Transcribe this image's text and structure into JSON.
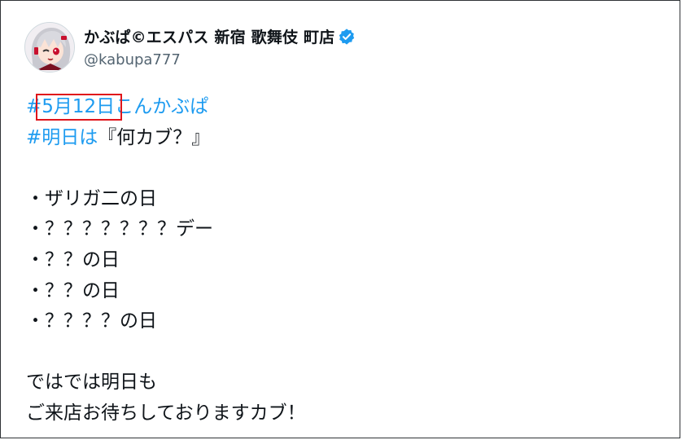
{
  "author": {
    "display_name": "かぶぱ©エスパス 新宿 歌舞伎 町店",
    "handle": "@kabupa777",
    "verified_badge_icon": "verified-badge-icon",
    "avatar_icon": "avatar-anime-character"
  },
  "post": {
    "line1": {
      "hash": "#",
      "highlighted": "5月12日",
      "rest": "こんかぶぱ"
    },
    "line2": {
      "tag": "#明日は",
      "rest": "『何カブ？』"
    },
    "items": [
      "・ザリガ二の日",
      "・？？？？？？？デー",
      "・？？の日",
      "・？？の日",
      "・？？？？の日"
    ],
    "closing": [
      "ではでは明日も",
      "ご来店お待ちしておりますカブ！"
    ]
  },
  "colors": {
    "link": "#1d9bf0",
    "highlight_box": "#e0151b",
    "verified": "#1d9bf0"
  }
}
